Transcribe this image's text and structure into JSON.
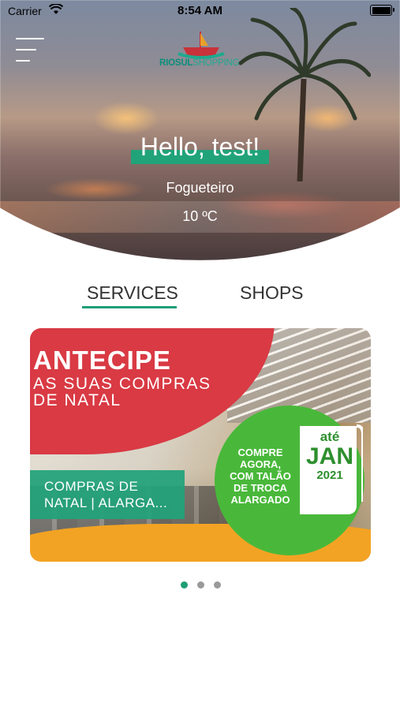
{
  "status_bar": {
    "carrier": "Carrier",
    "time": "8:54 AM"
  },
  "header": {
    "logo": {
      "part1": "RIOSUL",
      "part2": "SHOPPING"
    },
    "greeting": "Hello, test!",
    "location": "Fogueteiro",
    "temperature": "10 ºC"
  },
  "tabs": [
    {
      "label": "SERVICES",
      "active": true
    },
    {
      "label": "SHOPS",
      "active": false
    }
  ],
  "carousel": {
    "card": {
      "headline": "ANTECIPE",
      "subline1": "AS SUAS COMPRAS",
      "subline2": "DE NATAL",
      "promo": "COMPRE AGORA, COM TALÃO DE TROCA ALARGADO",
      "date_prefix": "até",
      "date_month": "JAN",
      "date_year": "2021",
      "caption": "COMPRAS DE NATAL | ALARGA..."
    },
    "page_count": 3,
    "active_index": 0
  },
  "colors": {
    "accent_green": "#1e9e76",
    "promo_red": "#d93a44",
    "promo_orange": "#f3a323",
    "promo_green": "#49b83a"
  }
}
